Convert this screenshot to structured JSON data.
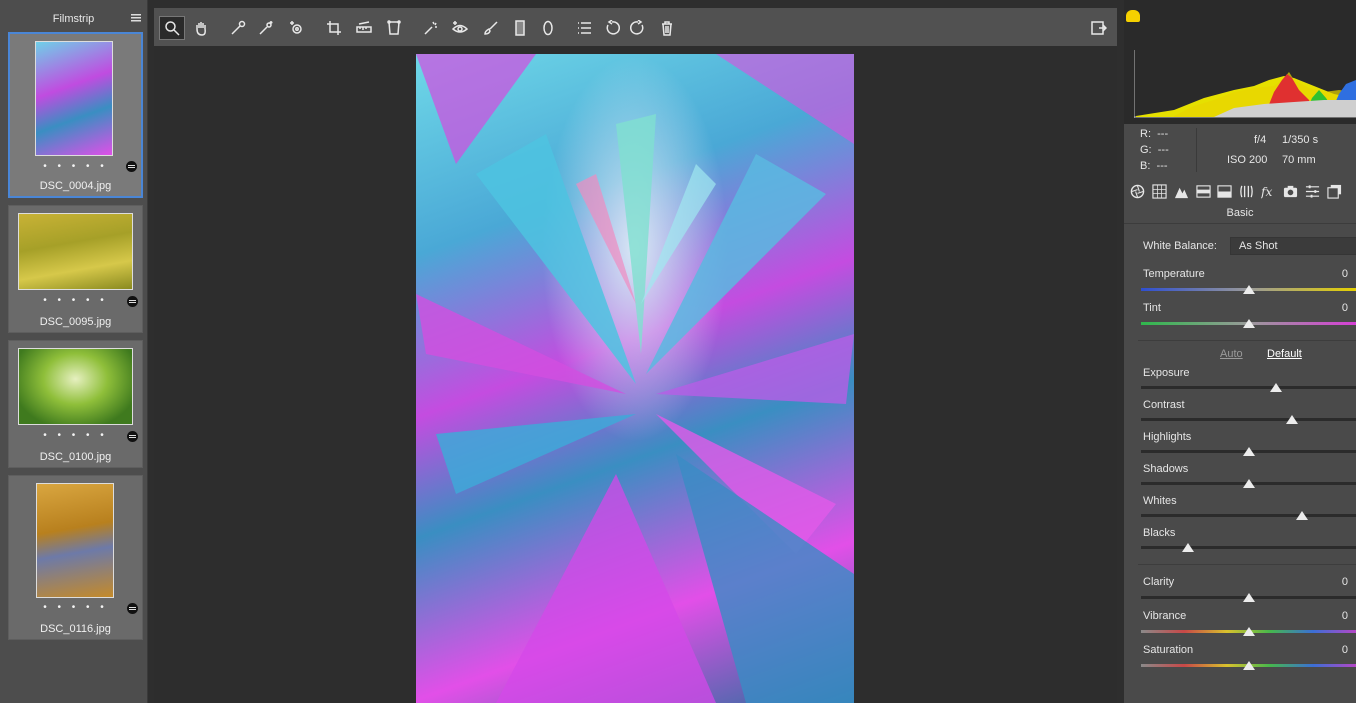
{
  "filmstrip": {
    "title": "Filmstrip",
    "items": [
      {
        "name": "DSC_0004.jpg",
        "dots": "• • • • •",
        "selected": true
      },
      {
        "name": "DSC_0095.jpg",
        "dots": "• • • • •",
        "selected": false
      },
      {
        "name": "DSC_0100.jpg",
        "dots": "• • • • •",
        "selected": false
      },
      {
        "name": "DSC_0116.jpg",
        "dots": "• • • • •",
        "selected": false
      }
    ]
  },
  "toolbar": {
    "tools": [
      "zoom-icon",
      "hand-icon",
      "white-balance-icon",
      "color-sampler-icon",
      "target-adjustment-icon",
      "crop-icon",
      "straighten-icon",
      "transform-icon",
      "spot-removal-icon",
      "red-eye-icon",
      "adjustment-brush-icon",
      "graduated-filter-icon",
      "radial-filter-icon",
      "preferences-icon",
      "rotate-left-icon",
      "rotate-right-icon",
      "trash-icon"
    ],
    "right_tool": "fullscreen-icon"
  },
  "info": {
    "r_label": "R:",
    "r_value": "---",
    "g_label": "G:",
    "g_value": "---",
    "b_label": "B:",
    "b_value": "---",
    "aperture": "f/4",
    "shutter": "1/350 s",
    "iso": "ISO 200",
    "focal": "70 mm"
  },
  "panel": {
    "title": "Basic",
    "white_balance_label": "White Balance:",
    "white_balance_value": "As Shot",
    "auto_label": "Auto",
    "default_label": "Default"
  },
  "sliders": {
    "temperature": {
      "label": "Temperature",
      "value": "0",
      "level": 0.5
    },
    "tint": {
      "label": "Tint",
      "value": "0",
      "level": 0.5
    },
    "exposure": {
      "label": "Exposure",
      "level": 0.63
    },
    "contrast": {
      "label": "Contrast",
      "level": 0.7
    },
    "highlights": {
      "label": "Highlights",
      "level": 0.5
    },
    "shadows": {
      "label": "Shadows",
      "level": 0.5
    },
    "whites": {
      "label": "Whites",
      "level": 0.75
    },
    "blacks": {
      "label": "Blacks",
      "level": 0.22
    },
    "clarity": {
      "label": "Clarity",
      "value": "0",
      "level": 0.5
    },
    "vibrance": {
      "label": "Vibrance",
      "value": "0",
      "level": 0.5
    },
    "saturation": {
      "label": "Saturation",
      "value": "0",
      "level": 0.5
    }
  },
  "colors": {
    "selection": "#4a86d6",
    "clip_warning": "#f5d000"
  }
}
